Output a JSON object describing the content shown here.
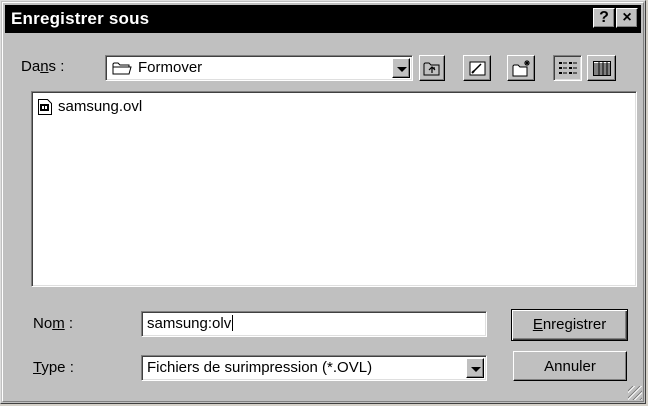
{
  "dialog": {
    "title": "Enregistrer sous",
    "help_label": "?",
    "close_label": "×"
  },
  "location": {
    "label_pre": "Da",
    "label_access": "n",
    "label_post": "s :",
    "folder": "Formover",
    "toolbar_icons": [
      "up-one-level-icon",
      "desktop-icon",
      "new-folder-icon",
      "list-view-icon",
      "details-view-icon"
    ]
  },
  "files": [
    {
      "name": "samsung.ovl",
      "icon": "file-icon"
    }
  ],
  "name_field": {
    "label_pre": "No",
    "label_access": "m",
    "label_post": " :",
    "value": "samsung:olv"
  },
  "type_field": {
    "label_access": "T",
    "label_post": "ype :",
    "value": "Fichiers de surimpression (*.OVL)"
  },
  "buttons": {
    "save_access": "E",
    "save_rest": "nregistrer",
    "cancel": "Annuler"
  }
}
